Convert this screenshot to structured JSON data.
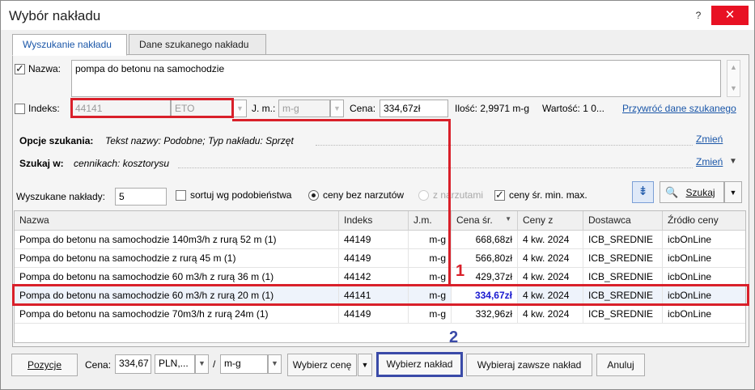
{
  "window": {
    "title": "Wybór nakładu",
    "help_btn": "?",
    "close_btn": "✕"
  },
  "tabs": [
    {
      "label": "Wyszukanie nakładu"
    },
    {
      "label": "Dane szukanego nakładu"
    }
  ],
  "search": {
    "name_label": "Nazwa:",
    "name_value": "pompa do betonu na samochodzie",
    "index_label": "Indeks:",
    "index_value": "44141",
    "index_suffix": "ETO",
    "unit_label": "J. m.:",
    "unit_value": "m-g",
    "price_label": "Cena:",
    "price_value": "334,67zł",
    "quantity_text": "Ilość: 2,9971 m-g",
    "value_text": "Wartość: 1 0...",
    "restore_link": "Przywróć dane szukanego",
    "options_label": "Opcje szukania:",
    "options_value": "Tekst nazwy: Podobne; Typ nakładu: Sprzęt",
    "options_change": "Zmień",
    "search_in_label": "Szukaj w:",
    "search_in_value": "cennikach: kosztorysu",
    "search_in_change": "Zmień",
    "found_label": "Wyszukane nakłady:",
    "found_value": "5",
    "sort_label": "sortuj wg podobieństwa",
    "radio_no_markup": "ceny bez narzutów",
    "radio_with_markup": "z narzutami",
    "minmax_label": "ceny śr. min. max.",
    "search_button": "Szukaj"
  },
  "table": {
    "columns": [
      "Nazwa",
      "Indeks",
      "J.m.",
      "Cena śr.",
      "Ceny z",
      "Dostawca",
      "Źródło ceny"
    ],
    "rows": [
      [
        "Pompa do betonu na samochodzie 140m3/h z rurą 52 m (1)",
        "44149",
        "m-g",
        "668,68zł",
        "4 kw. 2024",
        "ICB_SREDNIE",
        "icbOnLine"
      ],
      [
        "Pompa do betonu na samochodzie z rurą 45 m (1)",
        "44149",
        "m-g",
        "566,80zł",
        "4 kw. 2024",
        "ICB_SREDNIE",
        "icbOnLine"
      ],
      [
        "Pompa do betonu na samochodzie 60 m3/h z rurą 36 m (1)",
        "44142",
        "m-g",
        "429,37zł",
        "4 kw. 2024",
        "ICB_SREDNIE",
        "icbOnLine"
      ],
      [
        "Pompa do betonu na samochodzie 60 m3/h z rurą 20 m (1)",
        "44141",
        "m-g",
        "334,67zł",
        "4 kw. 2024",
        "ICB_SREDNIE",
        "icbOnLine"
      ],
      [
        "Pompa do betonu na samochodzie 70m3/h z rurą 24m (1)",
        "44149",
        "m-g",
        "332,96zł",
        "4 kw. 2024",
        "ICB_SREDNIE",
        "icbOnLine"
      ]
    ]
  },
  "bottom": {
    "positions_btn": "Pozycje",
    "price_label": "Cena:",
    "price_value": "334,67",
    "currency": "PLN,...",
    "slash": "/",
    "unit": "m-g",
    "choose_price_btn": "Wybierz cenę",
    "choose_item_btn": "Wybierz nakład",
    "always_choose_btn": "Wybieraj zawsze nakład",
    "cancel_btn": "Anuluj"
  },
  "annotations": {
    "marker1": "1",
    "marker2": "2",
    "red": "#d9202a",
    "blue": "#3a4aa8"
  }
}
